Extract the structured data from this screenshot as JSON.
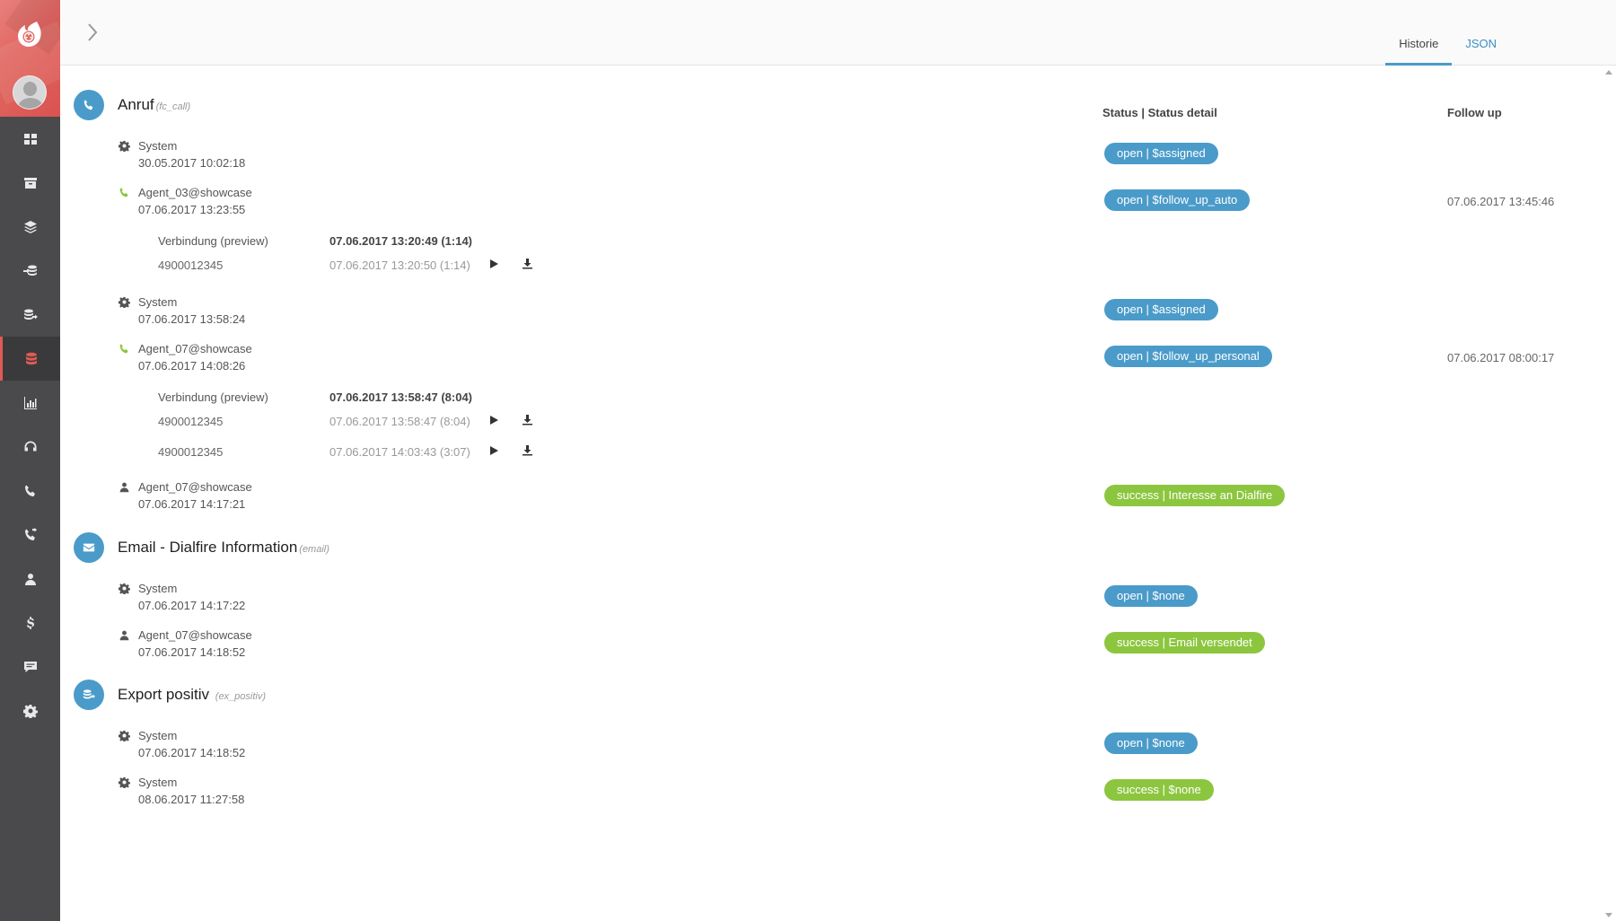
{
  "header": {
    "tabs": [
      {
        "label": "Historie",
        "active": true
      },
      {
        "label": "JSON",
        "active": false
      }
    ]
  },
  "columns": {
    "status": "Status | Status detail",
    "follow_up": "Follow up"
  },
  "colors": {
    "blue_badge": "#4a9bc9",
    "green_badge": "#8cc63f",
    "accent": "#e05a55"
  },
  "sections": [
    {
      "title": "Anruf",
      "code": "(fc_call)",
      "icon": "phone-icon",
      "entries": [
        {
          "icon": "gear-icon",
          "who": "System",
          "time": "30.05.2017 10:02:18",
          "status": "open | $assigned",
          "status_color": "blue",
          "follow_up": ""
        },
        {
          "icon": "phone-icon",
          "who": "Agent_03@showcase",
          "time": "07.06.2017 13:23:55",
          "status": "open | $follow_up_auto",
          "status_color": "blue",
          "follow_up": "07.06.2017 13:45:46",
          "connection": {
            "label": "Verbindung (preview)",
            "header": "07.06.2017 13:20:49 (1:14)",
            "calls": [
              {
                "number": "4900012345",
                "time": "07.06.2017 13:20:50 (1:14)"
              }
            ]
          }
        },
        {
          "icon": "gear-icon",
          "who": "System",
          "time": "07.06.2017 13:58:24",
          "status": "open | $assigned",
          "status_color": "blue",
          "follow_up": ""
        },
        {
          "icon": "phone-icon",
          "who": "Agent_07@showcase",
          "time": "07.06.2017 14:08:26",
          "status": "open | $follow_up_personal",
          "status_color": "blue",
          "follow_up": "07.06.2017 08:00:17",
          "connection": {
            "label": "Verbindung (preview)",
            "header": "07.06.2017 13:58:47 (8:04)",
            "calls": [
              {
                "number": "4900012345",
                "time": "07.06.2017 13:58:47 (8:04)"
              },
              {
                "number": "4900012345",
                "time": "07.06.2017 14:03:43 (3:07)"
              }
            ]
          }
        },
        {
          "icon": "user-icon",
          "who": "Agent_07@showcase",
          "time": "07.06.2017 14:17:21",
          "status": "success | Interesse an Dialfire",
          "status_color": "green",
          "follow_up": ""
        }
      ]
    },
    {
      "title": "Email - Dialfire Information",
      "code": "(email)",
      "icon": "envelope-icon",
      "entries": [
        {
          "icon": "gear-icon",
          "who": "System",
          "time": "07.06.2017 14:17:22",
          "status": "open | $none",
          "status_color": "blue",
          "follow_up": ""
        },
        {
          "icon": "user-icon",
          "who": "Agent_07@showcase",
          "time": "07.06.2017 14:18:52",
          "status": "success | Email versendet",
          "status_color": "green",
          "follow_up": ""
        }
      ]
    },
    {
      "title": "Export positiv",
      "code": "(ex_positiv)",
      "icon": "export-icon",
      "entries": [
        {
          "icon": "gear-icon",
          "who": "System",
          "time": "07.06.2017 14:18:52",
          "status": "open | $none",
          "status_color": "blue",
          "follow_up": ""
        },
        {
          "icon": "gear-icon",
          "who": "System",
          "time": "08.06.2017 11:27:58",
          "status": "success | $none",
          "status_color": "green",
          "follow_up": ""
        }
      ]
    }
  ]
}
